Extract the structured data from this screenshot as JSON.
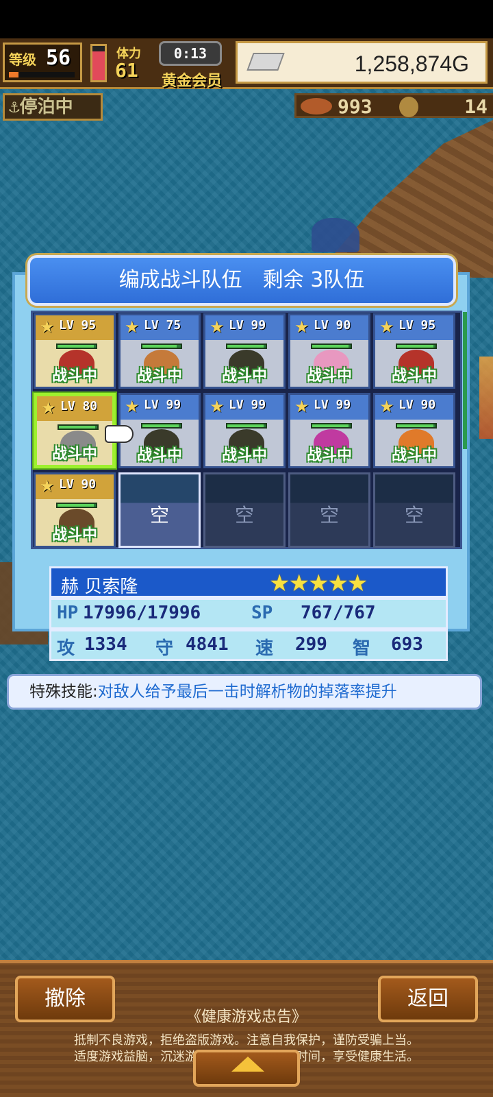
{
  "topbar": {
    "level_label": "等级",
    "level": "56",
    "level_progress": 0.15,
    "stamina_label": "体力",
    "stamina": "61",
    "stamina_fraction": 0.85,
    "timer": "0:13",
    "member": "黄金会员",
    "gold": "1,258,874G",
    "gold_icon": "silver-bar-icon",
    "docked": "⚓停泊中",
    "food": "993",
    "food_icon": "meat-icon",
    "medal": "14",
    "medal_icon": "coin-icon"
  },
  "panel": {
    "title": "编成战斗队伍　剩余 3队伍",
    "slots": [
      {
        "lv": "LV 95",
        "status": "战斗中",
        "style": "gold",
        "portrait": "#b5332a",
        "hp": 0.95
      },
      {
        "lv": "LV 75",
        "status": "战斗中",
        "style": "filled",
        "portrait": "#c57a3a",
        "hp": 0.9
      },
      {
        "lv": "LV 99",
        "status": "战斗中",
        "style": "filled",
        "portrait": "#3a3a2a",
        "hp": 0.95
      },
      {
        "lv": "LV 90",
        "status": "战斗中",
        "style": "filled",
        "portrait": "#e898c0",
        "hp": 0.95
      },
      {
        "lv": "LV 95",
        "status": "战斗中",
        "style": "filled",
        "portrait": "#b5332a",
        "hp": 0.95
      },
      {
        "lv": "LV 80",
        "status": "战斗中",
        "style": "gold",
        "portrait": "#8a8a8a",
        "hp": 0.95,
        "selected": true
      },
      {
        "lv": "LV 99",
        "status": "战斗中",
        "style": "filled",
        "portrait": "#3a3a2a",
        "hp": 0.95
      },
      {
        "lv": "LV 99",
        "status": "战斗中",
        "style": "filled",
        "portrait": "#3a3a2a",
        "hp": 0.95
      },
      {
        "lv": "LV 99",
        "status": "战斗中",
        "style": "filled",
        "portrait": "#c03aa0",
        "hp": 0.95
      },
      {
        "lv": "LV 90",
        "status": "战斗中",
        "style": "filled",
        "portrait": "#e07a2a",
        "hp": 0.95
      },
      {
        "lv": "LV 90",
        "status": "战斗中",
        "style": "gold",
        "portrait": "#6a4a2a",
        "hp": 0.95
      },
      {
        "empty": "空",
        "active": true
      },
      {
        "empty": "空"
      },
      {
        "empty": "空"
      },
      {
        "empty": "空"
      }
    ]
  },
  "info": {
    "name": "赫 贝索隆",
    "stars": "★★★★★",
    "hp_label": "HP",
    "hp": "17996/17996",
    "sp_label": "SP",
    "sp": "767/767",
    "atk_label": "攻",
    "atk": "1334",
    "def_label": "守",
    "def": "4841",
    "spd_label": "速",
    "spd": "299",
    "int_label": "智",
    "int": "693"
  },
  "skill": {
    "label": "特殊技能:",
    "desc": "对敌人给予最后一击时解析物的掉落率提升"
  },
  "bottom": {
    "remove": "撤除",
    "back": "返回",
    "health_title": "《健康游戏忠告》",
    "health_line1": "抵制不良游戏，拒绝盗版游戏。注意自我保护，谨防受骗上当。",
    "health_line2": "适度游戏益脑，沉迷游戏伤身。合理安排时间，享受健康生活。",
    "expand_icon": "up-arrow-icon"
  }
}
